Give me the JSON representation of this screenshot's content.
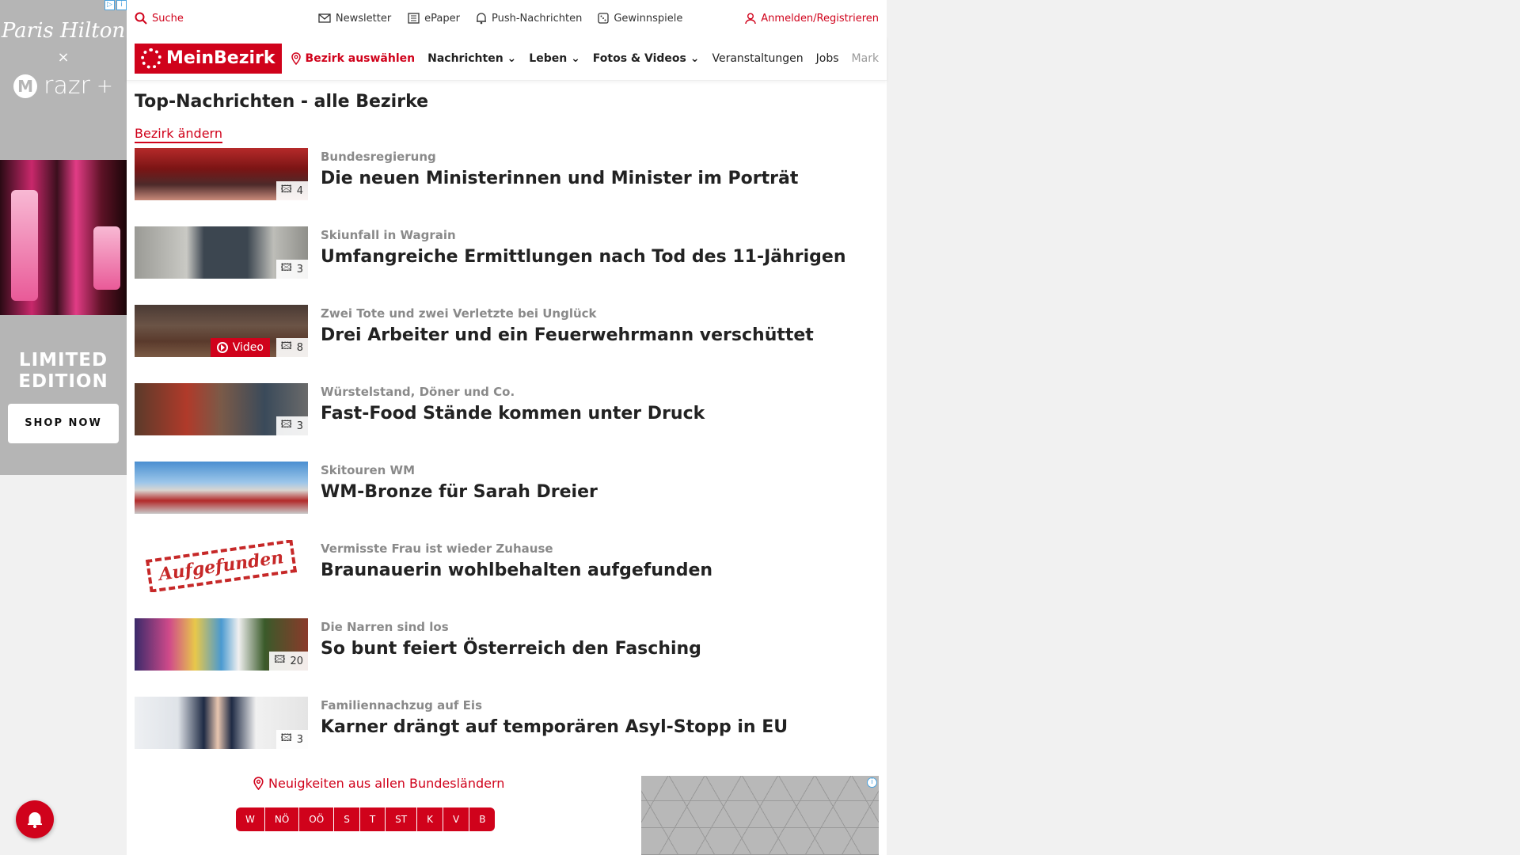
{
  "ad_left": {
    "signature": "Paris Hilton",
    "x": "×",
    "brand": "razr",
    "brand_sup": "+",
    "limited": "LIMITED EDITION",
    "shop": "SHOP NOW"
  },
  "util": {
    "search": "Suche",
    "newsletter": "Newsletter",
    "epaper": "ePaper",
    "push": "Push-Nachrichten",
    "gewinnspiele": "Gewinnspiele",
    "login": "Anmelden/Registrieren"
  },
  "nav": {
    "logo": "MeinBezirk",
    "bezirk": "Bezirk auswählen",
    "items": [
      "Nachrichten",
      "Leben",
      "Fotos & Videos",
      "Veranstaltungen",
      "Jobs",
      "Marktplatz"
    ]
  },
  "page_title": "Top-Nachrichten - alle Bezirke",
  "change_link": "Bezirk ändern",
  "articles": [
    {
      "kicker": "Bundesregierung",
      "headline": "Die neuen Ministerinnen und Minister im Porträt",
      "count": "4",
      "video": ""
    },
    {
      "kicker": "Skiunfall in Wagrain",
      "headline": "Umfangreiche Ermittlungen nach Tod des 11-Jährigen",
      "count": "3",
      "video": ""
    },
    {
      "kicker": "Zwei Tote und zwei Verletzte bei Unglück",
      "headline": "Drei Arbeiter und ein Feuerwehrmann verschüttet",
      "count": "8",
      "video": "Video"
    },
    {
      "kicker": "Würstelstand, Döner und Co.",
      "headline": "Fast-Food Stände kommen unter Druck",
      "count": "3",
      "video": ""
    },
    {
      "kicker": "Skitouren WM",
      "headline": "WM-Bronze für Sarah Dreier",
      "count": "",
      "video": ""
    },
    {
      "kicker": "Vermisste Frau ist wieder Zuhause",
      "headline": "Braunauerin wohlbehalten aufgefunden",
      "count": "",
      "video": "",
      "thumb_text": "Aufgefunden"
    },
    {
      "kicker": "Die Narren sind los",
      "headline": "So bunt feiert Österreich den Fasching",
      "count": "20",
      "video": ""
    },
    {
      "kicker": "Familiennachzug auf Eis",
      "headline": "Karner drängt auf temporären Asyl-Stopp in EU",
      "count": "3",
      "video": ""
    }
  ],
  "bottom": {
    "neuigkeiten": "Neuigkeiten aus allen Bundesländern",
    "states": [
      "W",
      "NÖ",
      "OÖ",
      "S",
      "T",
      "ST",
      "K",
      "V",
      "B"
    ]
  }
}
